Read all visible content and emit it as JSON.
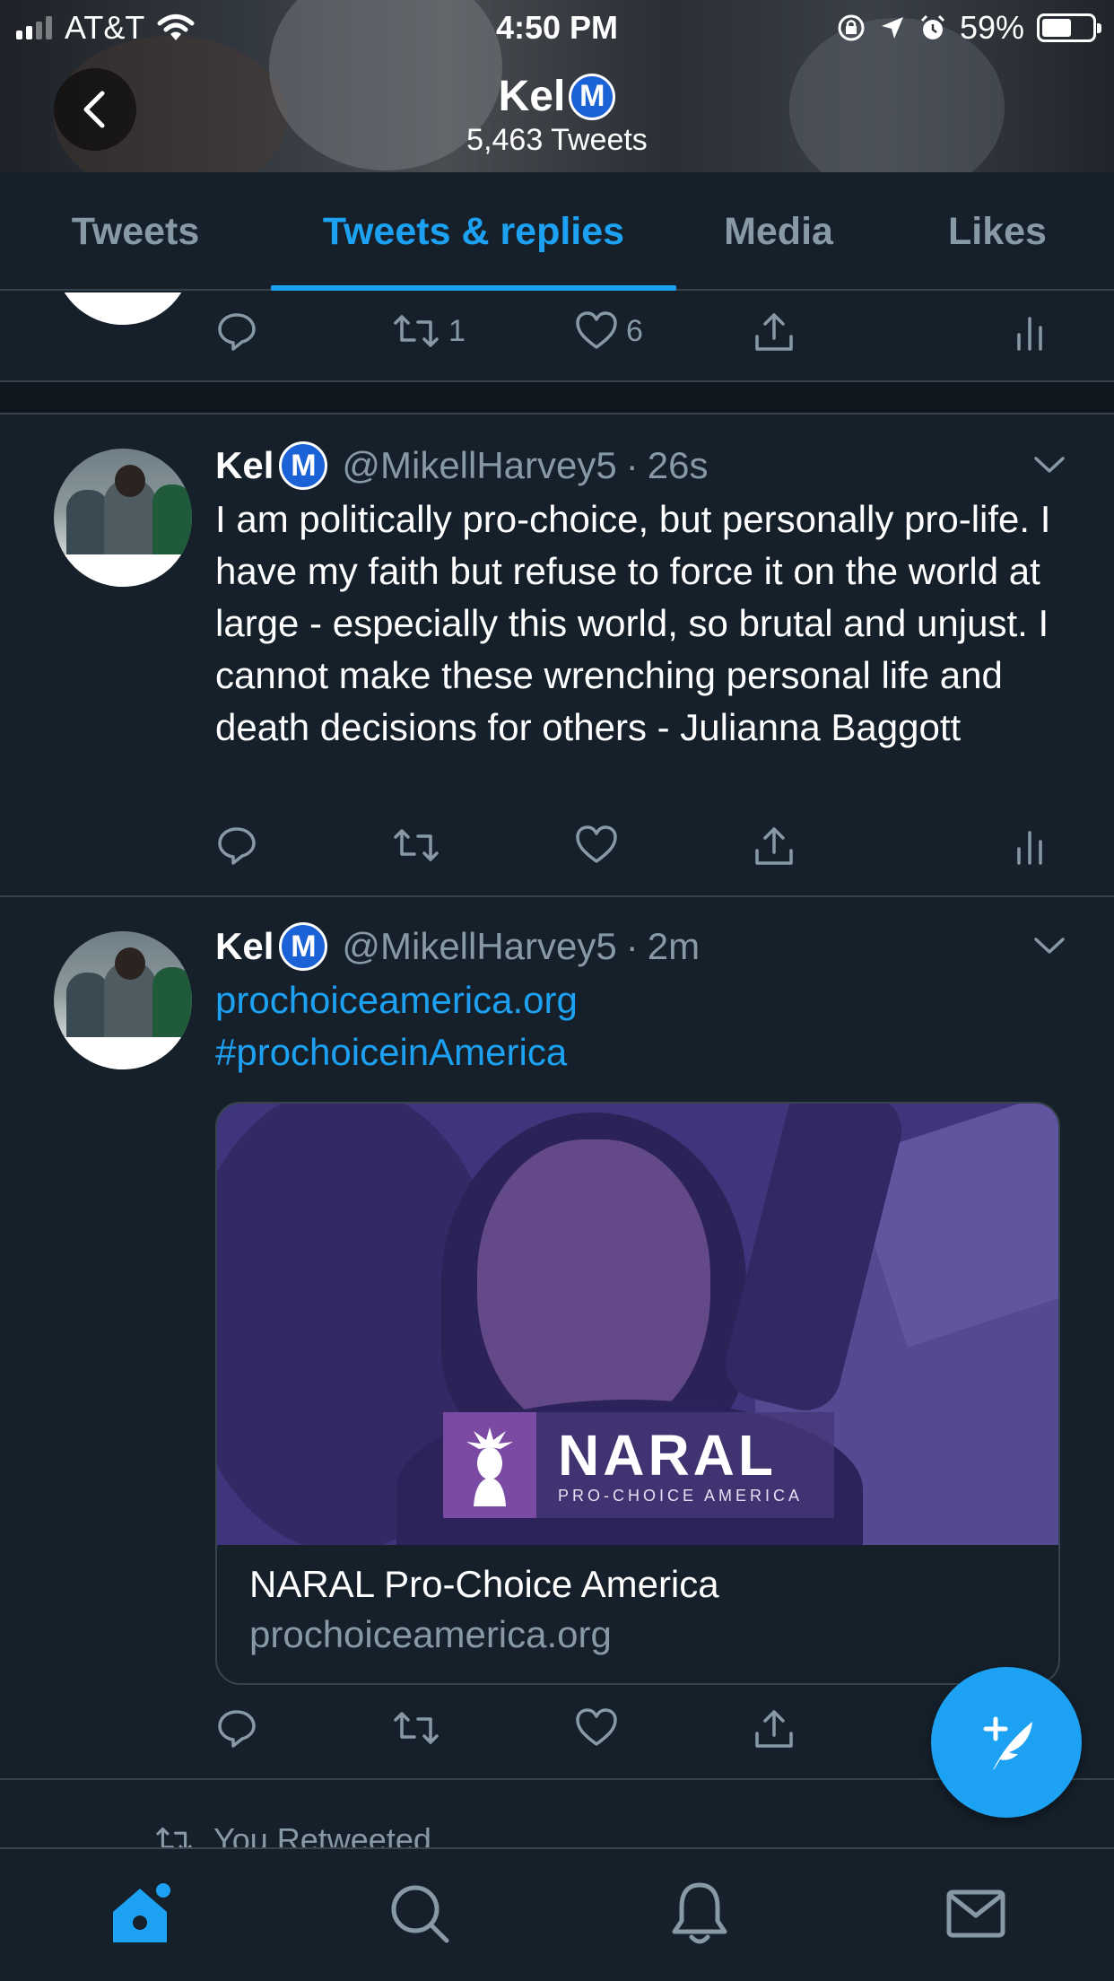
{
  "status_bar": {
    "carrier": "AT&T",
    "time": "4:50 PM",
    "battery_percent": "59%",
    "battery_level": 0.59
  },
  "profile_header": {
    "name": "Kel",
    "badge_letter": "M",
    "tweet_count": "5,463 Tweets"
  },
  "tabs": [
    {
      "label": "Tweets",
      "active": false
    },
    {
      "label": "Tweets & replies",
      "active": true
    },
    {
      "label": "Media",
      "active": false
    },
    {
      "label": "Likes",
      "active": false
    }
  ],
  "partial_tweet": {
    "retweet_count": "1",
    "like_count": "6"
  },
  "tweets": [
    {
      "name": "Kel",
      "badge_letter": "M",
      "handle": "@MikellHarvey5",
      "separator": "·",
      "time": "26s",
      "text": "I am politically pro-choice, but personally pro-life. I have my faith but refuse to force it on the world at large - especially this world, so brutal and unjust. I cannot make these wrenching personal life and death decisions for others -  Julianna Baggott"
    },
    {
      "name": "Kel",
      "badge_letter": "M",
      "handle": "@MikellHarvey5",
      "separator": "·",
      "time": "2m",
      "link_text": "prochoiceamerica.org",
      "hashtag": "#prochoiceinAmerica",
      "card": {
        "logo_big": "NARAL",
        "logo_small": "PRO-CHOICE AMERICA",
        "title": "NARAL Pro-Choice America",
        "domain": "prochoiceamerica.org"
      }
    }
  ],
  "retweet_notice": "You Retweeted",
  "colors": {
    "background": "#15202b",
    "accent": "#1da1f2",
    "muted": "#8899a6",
    "divider": "#38444d",
    "badge": "#1b62d6",
    "naral_purple": "#7b4aa3"
  },
  "icons": {
    "back": "chevron-left-icon",
    "reply": "reply-icon",
    "retweet": "retweet-icon",
    "like": "heart-icon",
    "share": "share-icon",
    "analytics": "analytics-icon",
    "caret": "chevron-down-icon",
    "compose": "compose-tweet-icon",
    "home": "home-icon",
    "search": "search-icon",
    "notifications": "bell-icon",
    "messages": "mail-icon"
  }
}
